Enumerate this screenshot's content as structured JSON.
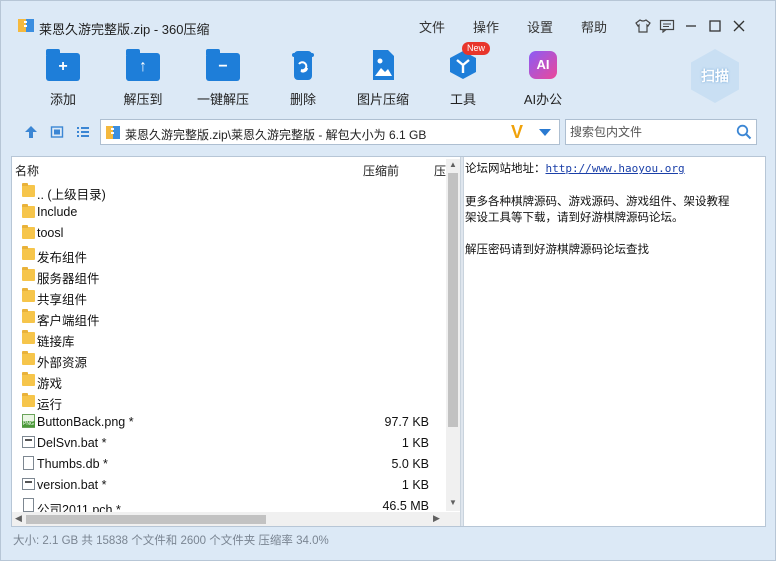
{
  "window": {
    "title": "莱恩久游完整版.zip - 360压缩",
    "menus": [
      "文件",
      "操作",
      "设置",
      "帮助"
    ]
  },
  "toolbar": {
    "add": "添加",
    "extract_to": "解压到",
    "one_click_extract": "一键解压",
    "delete": "删除",
    "image_compress": "图片压缩",
    "tools": "工具",
    "tools_badge": "New",
    "ai_office": "AI办公",
    "ai_icon_text": "AI",
    "scan": "扫描"
  },
  "address": {
    "path": "莱恩久游完整版.zip\\莱恩久游完整版 - 解包大小为 6.1 GB",
    "search_placeholder": "搜索包内文件"
  },
  "columns": {
    "name": "名称",
    "compressed_before": "压缩前",
    "compressed_after": "压"
  },
  "files": [
    {
      "name": ".. (上级目录)",
      "size": "",
      "type": "folder"
    },
    {
      "name": "Include",
      "size": "",
      "type": "folder"
    },
    {
      "name": "toosl",
      "size": "",
      "type": "folder"
    },
    {
      "name": "发布组件",
      "size": "",
      "type": "folder"
    },
    {
      "name": "服务器组件",
      "size": "",
      "type": "folder"
    },
    {
      "name": "共享组件",
      "size": "",
      "type": "folder"
    },
    {
      "name": "客户端组件",
      "size": "",
      "type": "folder"
    },
    {
      "name": "链接库",
      "size": "",
      "type": "folder"
    },
    {
      "name": "外部资源",
      "size": "",
      "type": "folder"
    },
    {
      "name": "游戏",
      "size": "",
      "type": "folder"
    },
    {
      "name": "运行",
      "size": "",
      "type": "folder"
    },
    {
      "name": "ButtonBack.png *",
      "size": "97.7 KB",
      "type": "png"
    },
    {
      "name": "DelSvn.bat *",
      "size": "1 KB",
      "type": "bat"
    },
    {
      "name": "Thumbs.db *",
      "size": "5.0 KB",
      "type": "doc"
    },
    {
      "name": "version.bat *",
      "size": "1 KB",
      "type": "bat"
    },
    {
      "name": "公司2011.pch *",
      "size": "46.5 MB",
      "type": "doc"
    }
  ],
  "comment": {
    "forum_label": "论坛网站地址：",
    "forum_url": "http://www.haoyou.org",
    "line2": "更多各种棋牌源码、游戏源码、游戏组件、架设教程",
    "line3": "架设工具等下载，请到好游棋牌源码论坛。",
    "line4": "解压密码请到好游棋牌源码论坛查找"
  },
  "status": {
    "text": "大小: 2.1 GB 共 15838 个文件和 2600 个文件夹 压缩率 34.0%"
  },
  "colors": {
    "accent": "#1e7ed9",
    "folder": "#f6c54b",
    "badge": "#e8352b"
  }
}
